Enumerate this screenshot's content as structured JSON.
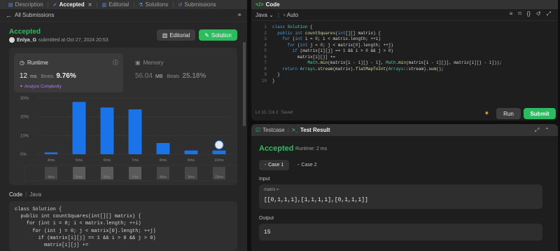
{
  "left_tabs": {
    "description": "Description",
    "accepted": "Accepted",
    "editorial": "Editorial",
    "solutions": "Solutions",
    "submissions": "Submissions"
  },
  "subheader": {
    "back_label": "All Submissions"
  },
  "submission": {
    "status": "Accepted",
    "user": "Enlya_G",
    "submitted_text": "submitted at Oct 27, 2024 20:53",
    "editorial_label": "Editorial",
    "solution_label": "Solution"
  },
  "runtime": {
    "label": "Runtime",
    "value": "12",
    "unit": "ms",
    "beats_label": "Beats",
    "beats": "9.76%",
    "analyze_label": "Analyze Complexity"
  },
  "memory": {
    "label": "Memory",
    "value": "56.04",
    "unit": "MB",
    "beats_label": "Beats",
    "beats": "25.18%"
  },
  "chart_data": {
    "type": "bar",
    "categories": [
      "4ms",
      "5ms",
      "6ms",
      "7ms",
      "8ms",
      "9ms",
      "10ms"
    ],
    "values": [
      1,
      28,
      25,
      24,
      6,
      2,
      2
    ],
    "ylim": [
      0,
      30
    ],
    "yticks": [
      "0%",
      "10%",
      "20%",
      "30%"
    ],
    "highlight_index": 6,
    "colors": {
      "bar": "#1a73e8",
      "grid": "#444444"
    },
    "grid": true
  },
  "code_section": {
    "label": "Code",
    "language": "Java",
    "lines": [
      "class Solution {",
      "  public int countSquares(int[][] matrix) {",
      "    for (int i = 0; i < matrix.length; ++i)",
      "      for (int j = 0; j < matrix[0].length; ++j)",
      "        if (matrix[i][j] == 1 && i > 0 && j > 0)",
      "          matrix[i][j] +="
    ]
  },
  "editor": {
    "title": "Code",
    "language": "Java",
    "mode": "Auto",
    "line_numbers": [
      "1",
      "2",
      "3",
      "4",
      "5",
      "6",
      "7",
      "8",
      "9",
      "10"
    ],
    "status": "Ln 10, Col 2",
    "saved": "Saved",
    "run_label": "Run",
    "submit_label": "Submit"
  },
  "results": {
    "testcase_tab": "Testcase",
    "result_tab": "Test Result",
    "status": "Accepted",
    "runtime_text": "Runtime: 2 ms",
    "cases": [
      "Case 1",
      "Case 2"
    ],
    "input_label": "Input",
    "param_name": "matrix =",
    "param_value": "[[0,1,1,1],[1,1,1,1],[0,1,1,1]]",
    "output_label": "Output",
    "output_value": "15"
  }
}
